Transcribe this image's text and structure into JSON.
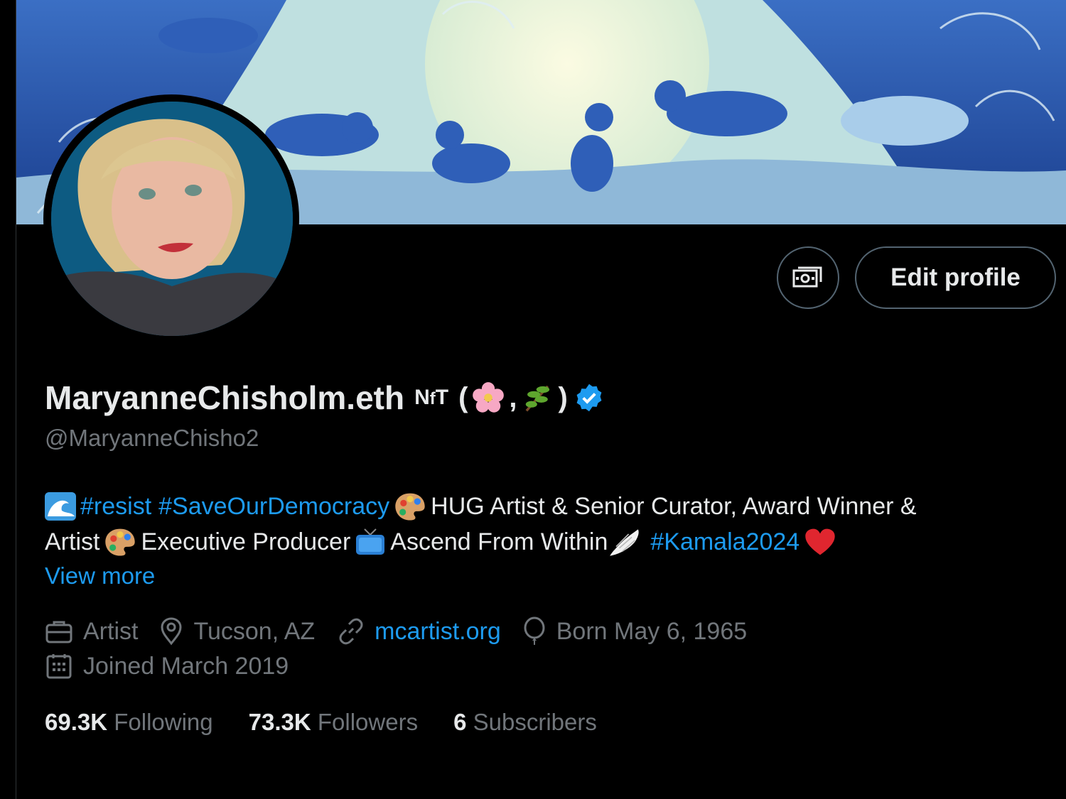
{
  "profile": {
    "display_name": "MaryanneChisholm.eth",
    "name_suffix": "NfT (",
    "name_comma": ",",
    "name_close": ")",
    "handle": "@MaryanneChisho2"
  },
  "actions": {
    "edit_profile_label": "Edit profile",
    "icon_button": "money-icon"
  },
  "bio": {
    "line1": [
      {
        "type": "emoji",
        "icon": "wave-icon"
      },
      {
        "type": "tag",
        "text": "#resist"
      },
      {
        "type": "tag",
        "text": "#SaveOurDemocracy"
      },
      {
        "type": "emoji",
        "icon": "palette-icon"
      },
      {
        "type": "text",
        "text": "HUG Artist & Senior Curator, Award Winner &"
      }
    ],
    "line2": [
      {
        "type": "text",
        "text": "Artist"
      },
      {
        "type": "emoji",
        "icon": "palette-icon"
      },
      {
        "type": "text",
        "text": "Executive Producer"
      },
      {
        "type": "emoji",
        "icon": "tv-icon"
      },
      {
        "type": "text",
        "text": "Ascend From Within"
      },
      {
        "type": "emoji",
        "icon": "wing-icon"
      },
      {
        "type": "tag",
        "text": "#Kamala2024"
      },
      {
        "type": "emoji",
        "icon": "heart-icon"
      }
    ],
    "view_more": "View more"
  },
  "meta": {
    "profession": "Artist",
    "location": "Tucson, AZ",
    "website": "mcartist.org",
    "birthday": "Born May 6, 1965",
    "joined": "Joined March 2019"
  },
  "stats": {
    "following_count": "69.3K",
    "following_label": "Following",
    "followers_count": "73.3K",
    "followers_label": "Followers",
    "subscribers_count": "6",
    "subscribers_label": "Subscribers"
  },
  "colors": {
    "background": "#000000",
    "text": "#e7e9ea",
    "muted": "#71767b",
    "accent": "#1d9bf0",
    "border": "#536471"
  }
}
